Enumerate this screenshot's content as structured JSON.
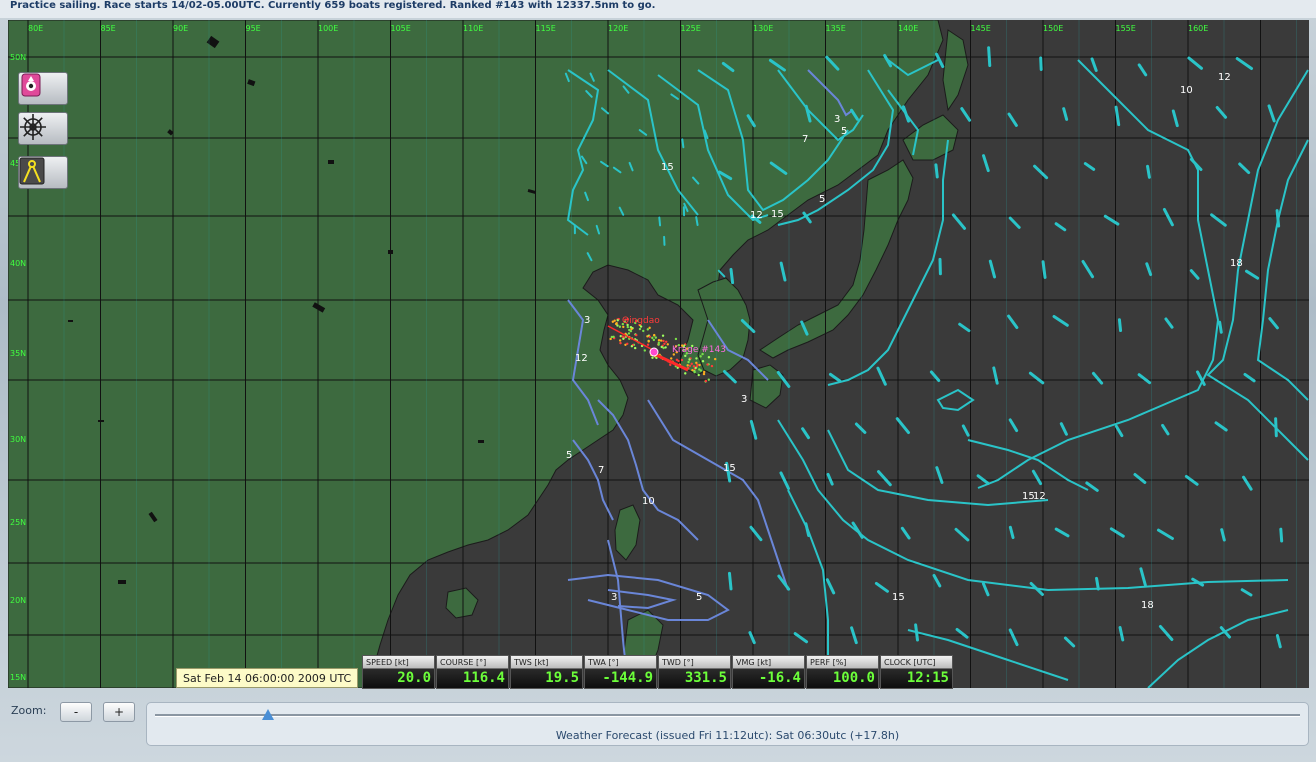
{
  "status": {
    "message": "Practice sailing. Race starts 14/02-05.00UTC. Currently 659 boats registered. Ranked #143 with 12337.5nm to go."
  },
  "map": {
    "lon_labels": [
      "80E",
      "85E",
      "90E",
      "95E",
      "100E",
      "105E",
      "110E",
      "115E",
      "120E",
      "125E",
      "130E",
      "135E",
      "140E",
      "145E",
      "150E",
      "155E",
      "160E"
    ],
    "lat_labels": [
      "50N",
      "45N",
      "40N",
      "35N",
      "30N",
      "25N",
      "20N",
      "15N"
    ],
    "isobar_labels": [
      "3",
      "5",
      "7",
      "12",
      "15",
      "10",
      "12",
      "15",
      "5",
      "3",
      "12",
      "3",
      "5",
      "7",
      "10",
      "15",
      "18",
      "15",
      "18",
      "3",
      "5",
      "15",
      "12"
    ],
    "route_labels": {
      "start": "Qingdao",
      "boat": "Krage #143"
    },
    "colors": {
      "land": "#3d6a3f",
      "sea": "#3a3a3a",
      "grid": "#111111",
      "isobar_light": "#2ac4c8",
      "isobar_dark": "#6a86d8",
      "lat_lon_label": "#40ff40",
      "boat": "#ff2a2a"
    }
  },
  "tools": [
    {
      "icon": "compass-icon"
    },
    {
      "icon": "helm-icon"
    },
    {
      "icon": "divider-icon"
    }
  ],
  "datetime": "Sat Feb 14 06:00:00 2009 UTC",
  "instruments": [
    {
      "label": "SPEED [kt]",
      "value": "20.0"
    },
    {
      "label": "COURSE [°]",
      "value": "116.4"
    },
    {
      "label": "TWS [kt]",
      "value": "19.5"
    },
    {
      "label": "TWA [°]",
      "value": "-144.9"
    },
    {
      "label": "TWD [°]",
      "value": "331.5"
    },
    {
      "label": "VMG [kt]",
      "value": "-16.4"
    },
    {
      "label": "PERF [%]",
      "value": "100.0"
    },
    {
      "label": "CLOCK [UTC]",
      "value": "12:15"
    }
  ],
  "zoom": {
    "label": "Zoom:",
    "minus": "-",
    "plus": "+",
    "level": 0.1
  },
  "forecast": {
    "text": "Weather Forecast  (issued Fri 11:12utc): Sat 06:30utc  (+17.8h)"
  }
}
